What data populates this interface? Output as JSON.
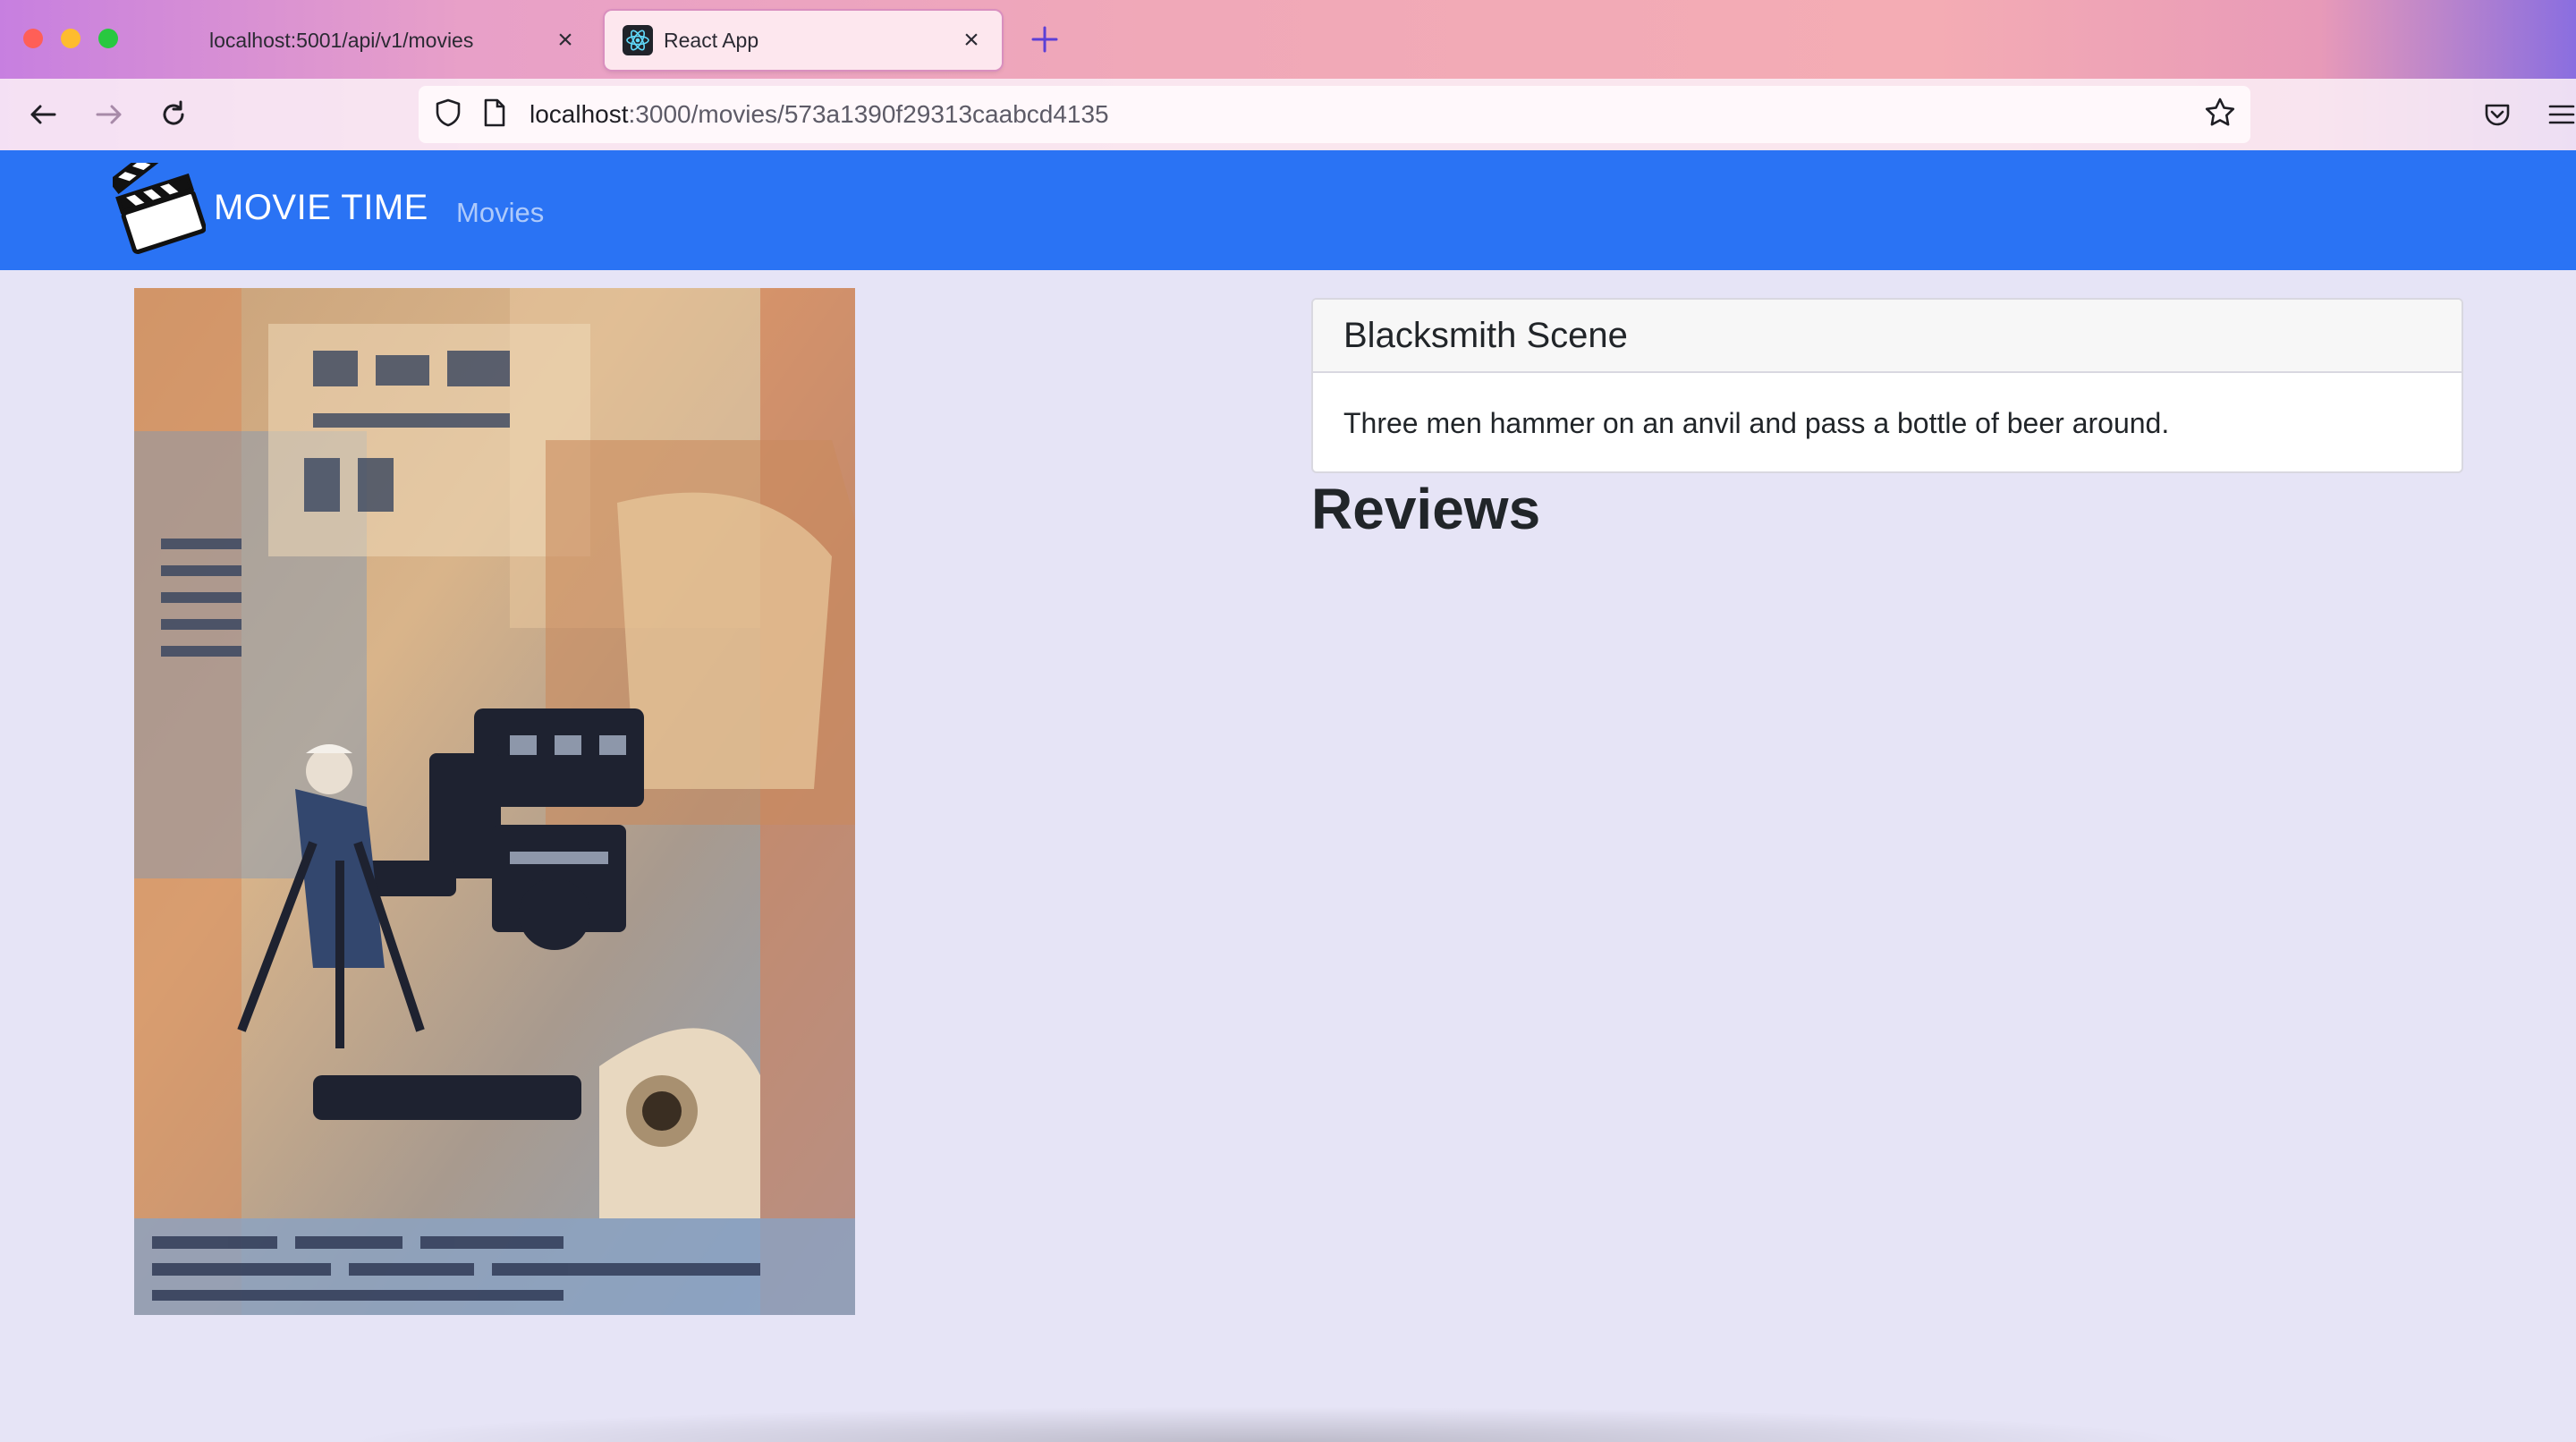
{
  "browser": {
    "tabs": [
      {
        "label": "localhost:5001/api/v1/movies",
        "active": false
      },
      {
        "label": "React App",
        "active": true
      }
    ],
    "url_host": "localhost",
    "url_rest": ":3000/movies/573a1390f29313caabcd4135",
    "icons": [
      "back-arrow-icon",
      "forward-arrow-icon",
      "reload-icon",
      "shield-icon",
      "page-icon",
      "star-icon",
      "pocket-icon",
      "hamburger-menu-icon",
      "new-tab-icon",
      "react-icon",
      "close-icon"
    ]
  },
  "app": {
    "brand": "MOVIE TIME",
    "nav_link": "Movies",
    "brand_color": "#2a73f4",
    "background_color": "#e6e4f6"
  },
  "movie": {
    "title": "Blacksmith Scene",
    "plot": "Three men hammer on an anvil and pass a bottle of beer around.",
    "poster_alt": "movie poster"
  },
  "reviews": {
    "heading": "Reviews",
    "items": []
  }
}
